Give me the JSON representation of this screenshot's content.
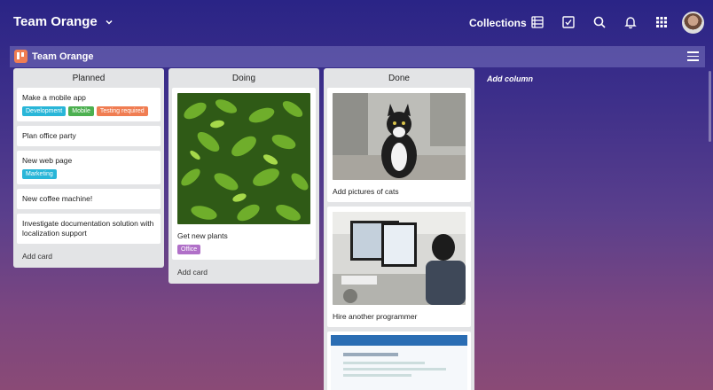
{
  "header": {
    "team_name": "Team Orange",
    "collections_label": "Collections"
  },
  "icons": {
    "list": "list-icon",
    "check": "checkbox-icon",
    "search": "search-icon",
    "bell": "bell-icon",
    "grid": "grid-icon"
  },
  "board": {
    "name": "Team Orange"
  },
  "columns": [
    {
      "title": "Planned",
      "cards": [
        {
          "title": "Make a mobile app",
          "labels": [
            {
              "text": "Development",
              "color": "#29b6d8"
            },
            {
              "text": "Mobile",
              "color": "#4cb050"
            },
            {
              "text": "Testing required",
              "color": "#f07d52"
            }
          ]
        },
        {
          "title": "Plan office party",
          "labels": []
        },
        {
          "title": "New web page",
          "labels": [
            {
              "text": "Marketing",
              "color": "#29b6d8"
            }
          ]
        },
        {
          "title": "New coffee machine!",
          "labels": []
        },
        {
          "title": "Investigate documentation solution with localization support",
          "labels": []
        }
      ],
      "add_card": "Add card"
    },
    {
      "title": "Doing",
      "cards": [
        {
          "title": "Get new plants",
          "labels": [
            {
              "text": "Office",
              "color": "#b070c8"
            }
          ]
        }
      ],
      "add_card": "Add card"
    },
    {
      "title": "Done",
      "cards": [
        {
          "title": "Add pictures of cats",
          "labels": []
        },
        {
          "title": "Hire another programmer",
          "labels": []
        }
      ]
    }
  ],
  "add_column_label": "Add column",
  "colors": {
    "accent": "#f07d52"
  }
}
